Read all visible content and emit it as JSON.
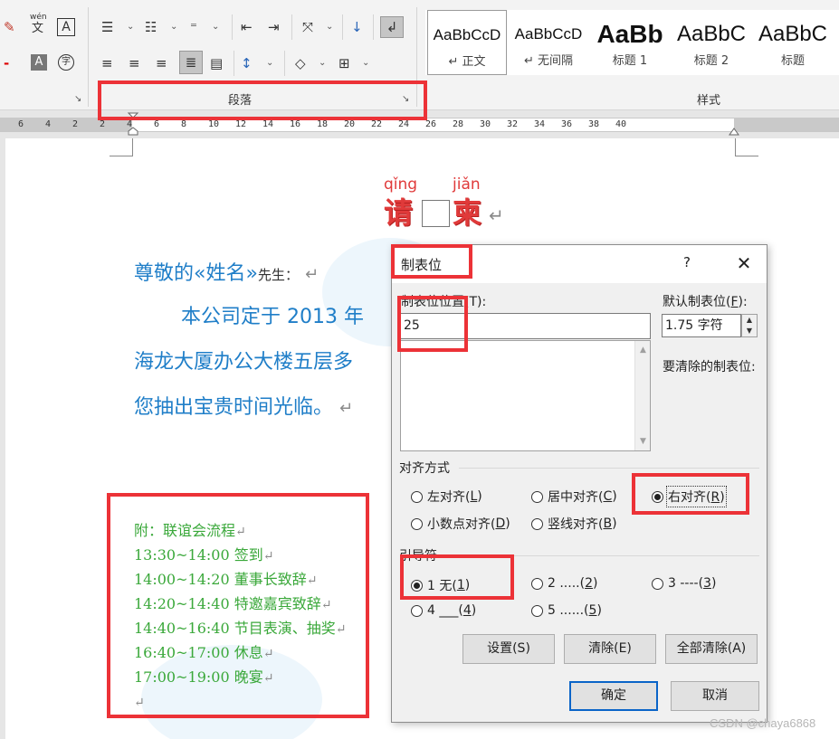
{
  "ribbon": {
    "font_icons": {
      "clear_format": "✎",
      "phonetic_top": "wén",
      "phonetic_bottom": "文",
      "char_border": "A",
      "dash": "-",
      "shade_a": "A",
      "enclose": "字"
    },
    "paragraph_icons": {
      "bullets": "☰",
      "numbering": "☷",
      "multilevel": "⁼",
      "decrease_indent": "⇤",
      "increase_indent": "⇥",
      "chinese_layout": "⤧",
      "sort": "↓",
      "show_marks": "↲",
      "align_left": "≡",
      "center": "≡",
      "align_right": "≡",
      "justify": "≣",
      "distributed": "▤",
      "line_spacing": "↕",
      "shading": "◇",
      "borders": "⊞",
      "caret": "⌄"
    },
    "paragraph_label": "段落",
    "styles_label": "样式",
    "launcher": "↘",
    "styles": [
      {
        "sample": "AaBbCcD",
        "name": "↵ 正文"
      },
      {
        "sample": "AaBbCcD",
        "name": "↵ 无间隔"
      },
      {
        "sample": "AaBb",
        "name": "标题 1"
      },
      {
        "sample": "AaBbC",
        "name": "标题 2"
      },
      {
        "sample": "AaBbC",
        "name": "标题"
      }
    ]
  },
  "ruler": {
    "numbers": [
      "6",
      "4",
      "2",
      "2",
      "4",
      "6",
      "8",
      "10",
      "12",
      "14",
      "16",
      "18",
      "20",
      "22",
      "24",
      "26",
      "28",
      "30",
      "32",
      "34",
      "36",
      "38",
      "40"
    ]
  },
  "document": {
    "title_pinyin_1": "qǐng",
    "title_pinyin_2": "jiǎn",
    "title_char_1": "请",
    "title_char_2": "柬",
    "return_mark": "↵",
    "greeting": "尊敬的«姓名»",
    "greeting_suffix": "先生",
    "greeting_colon": "：",
    "line2": "本公司定于 2013 年",
    "line3": "海龙大厦办公大楼五层多",
    "line4": "您抽出宝贵时间光临。",
    "schedule": [
      "附：联谊会流程",
      "13:30~14:00 签到",
      "14:00~14:20 董事长致辞",
      "14:20~14:40 特邀嘉宾致辞",
      "14:40~16:40 节目表演、抽奖",
      "16:40~17:00 休息",
      "17:00~19:00 晚宴",
      ""
    ]
  },
  "dialog": {
    "title": "制表位",
    "help": "?",
    "close": "✕",
    "tab_position_label": "制表位位置(T):",
    "tab_position_value": "25",
    "default_tab_label_pre": "默认制表位(",
    "default_tab_label_key": "F",
    "default_tab_label_post": "):",
    "default_tab_value": "1.75 字符",
    "clear_label": "要清除的制表位:",
    "alignment_label": "对齐方式",
    "alignment_options": [
      {
        "text": "左对齐(",
        "key": "L",
        "close": ")"
      },
      {
        "text": "居中对齐(",
        "key": "C",
        "close": ")"
      },
      {
        "text": "右对齐(",
        "key": "R",
        "close": ")"
      },
      {
        "text": "小数点对齐(",
        "key": "D",
        "close": ")"
      },
      {
        "text": "竖线对齐(",
        "key": "B",
        "close": ")"
      }
    ],
    "alignment_selected": "右对齐",
    "leader_label": "引导符",
    "leader_options": [
      {
        "text": "1 无(",
        "key": "1",
        "close": ")"
      },
      {
        "text": "2 .....(",
        "key": "2",
        "close": ")"
      },
      {
        "text": "3 ----(",
        "key": "3",
        "close": ")"
      },
      {
        "text": "4 ___(",
        "key": "4",
        "close": ")"
      },
      {
        "text": "5 ......(",
        "key": "5",
        "close": ")"
      }
    ],
    "leader_selected": "1 无",
    "buttons": {
      "set": "设置(S)",
      "clear": "清除(E)",
      "clear_all": "全部清除(A)",
      "ok": "确定",
      "cancel": "取消"
    },
    "scroll_up": "▲",
    "scroll_down": "▼",
    "spin_up": "▲",
    "spin_down": "▼"
  },
  "watermark_text": "CSDN @chaya6868",
  "colors": {
    "annotation": "#ec3237",
    "title_red": "#e03a3a",
    "body_blue": "#1f7ec8",
    "schedule_green": "#3aa83a",
    "default_button_border": "#0a64c8"
  }
}
